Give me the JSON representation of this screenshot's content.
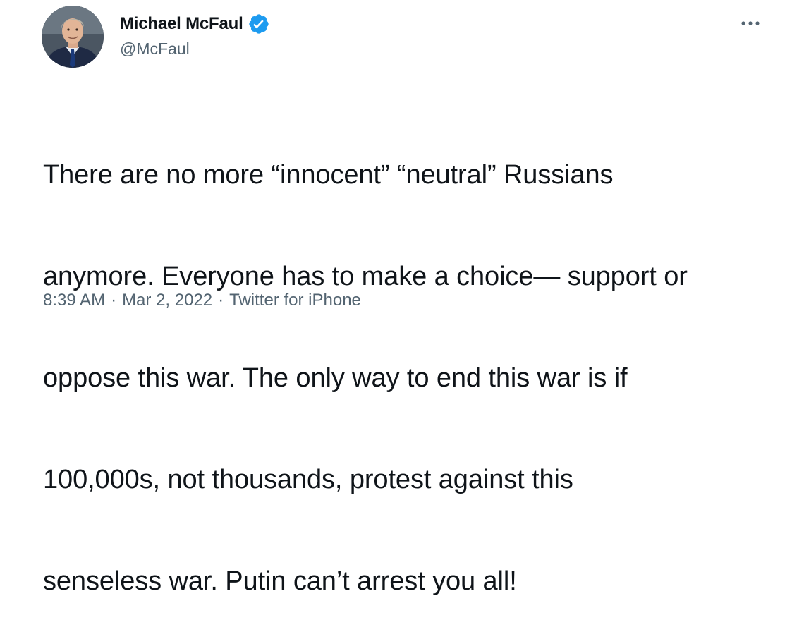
{
  "author": {
    "display_name": "Michael McFaul",
    "handle": "@McFaul",
    "verified_icon": "verified-badge-icon",
    "avatar": "profile-photo"
  },
  "menu": {
    "icon": "more-options-icon"
  },
  "tweet": {
    "lines": [
      "There are no more “innocent” “neutral” Russians",
      "anymore. Everyone has to make a choice— support or",
      "oppose this war. The only way to end this war is if",
      "100,000s, not thousands, protest against this",
      "senseless war. Putin can’t arrest you all!"
    ]
  },
  "meta": {
    "time": "8:39 AM",
    "separator": "·",
    "date": "Mar 2, 2022",
    "source": "Twitter for iPhone"
  },
  "colors": {
    "text": "#0f1419",
    "secondary": "#536471",
    "verified": "#1d9bf0"
  }
}
